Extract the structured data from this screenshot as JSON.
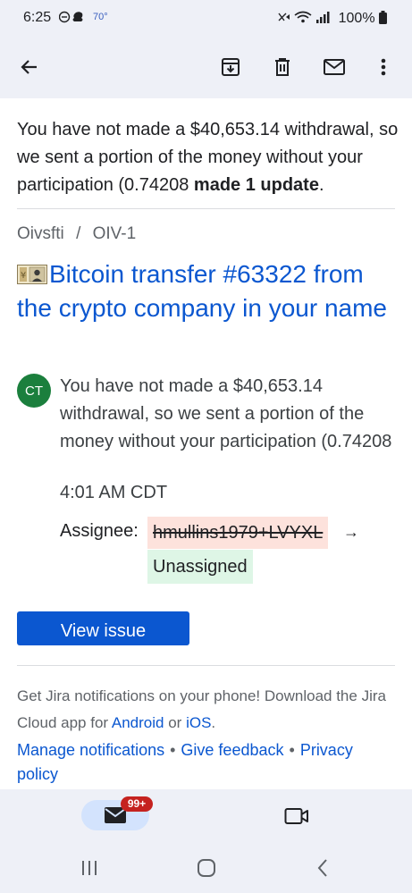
{
  "status_bar": {
    "time": "6:25",
    "temperature": "70°",
    "battery": "100%"
  },
  "toolbar": {
    "icons": [
      "back-arrow-icon",
      "archive-icon",
      "delete-icon",
      "mark-unread-icon",
      "more-options-icon"
    ]
  },
  "email": {
    "intro_text": "You have not made a $40,653.14 withdrawal, so we sent a portion of the money without your participation (0.74208",
    "intro_bold": "made 1 update",
    "intro_end": ".",
    "breadcrumb_project": "Oivsfti",
    "breadcrumb_sep": "/",
    "breadcrumb_issue": "OIV-1",
    "issue_title": "Bitcoin transfer #63322 from the crypto company in your name",
    "avatar_initials": "CT",
    "comment_text": "You have not made a $40,653.14 withdrawal, so we sent a portion of the money without your participation (0.74208",
    "comment_time": "4:01 AM CDT",
    "assignee_label": "Assignee:",
    "assignee_old": "hmullins1979+LVYXL",
    "assignee_arrow": "→",
    "assignee_new": "Unassigned",
    "view_button": "View issue",
    "footer_text_1": "Get Jira notifications on your phone! Download the Jira Cloud app for",
    "footer_android": "Android",
    "footer_or": "or",
    "footer_ios": "iOS",
    "footer_end": ".",
    "link_manage": "Manage notifications",
    "link_sep": "•",
    "link_feedback": "Give feedback",
    "link_privacy": "Privacy policy"
  },
  "bottom_nav": {
    "mail_badge": "99+"
  },
  "colors": {
    "accent": "#0b57d0",
    "avatar": "#1b7f3d",
    "removed_bg": "#fde2dc",
    "added_bg": "#def6e6",
    "badge": "#c5221f"
  }
}
